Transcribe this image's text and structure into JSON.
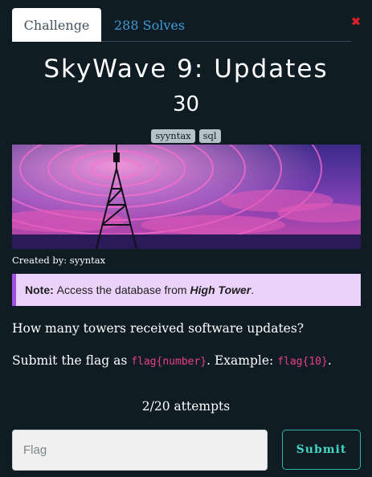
{
  "tabs": {
    "challenge_label": "Challenge",
    "solves_label": "288 Solves"
  },
  "close_icon": "close-icon",
  "challenge": {
    "title": "SkyWave 9: Updates",
    "points": "30",
    "tags": [
      "syyntax",
      "sql"
    ],
    "author_prefix": "Created by: ",
    "author": "syyntax"
  },
  "note": {
    "label": "Note:",
    "text": "Access the database from",
    "highlight": "High Tower",
    "end": "."
  },
  "question": "How many towers received software updates?",
  "submit_instructions": {
    "prefix": "Submit the flag as ",
    "format": "flag{number}",
    "middle": ". Example: ",
    "example": "flag{10}",
    "end": "."
  },
  "attempts": "2/20 attempts",
  "form": {
    "placeholder": "Flag",
    "submit_label": "Submit"
  },
  "colors": {
    "background": "#0f1c24",
    "accent": "#45d5c2",
    "link": "#3f9cd6",
    "note_border": "#a24ee0",
    "code": "#e83e8c"
  }
}
